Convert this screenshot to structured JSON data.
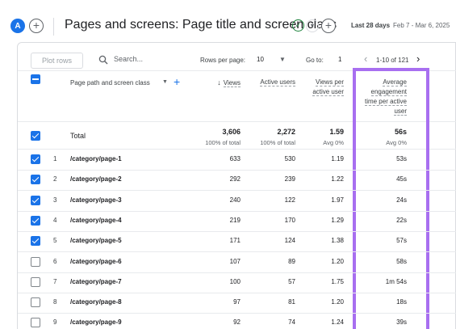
{
  "header": {
    "avatar_letter": "A",
    "title": "Pages and screens: Page title and screen class",
    "date_label": "Last 28 days",
    "date_range": "Feb 7 - Mar 6, 2025"
  },
  "toolbar": {
    "plot_rows_label": "Plot rows",
    "search_placeholder": "Search...",
    "rows_per_page_label": "Rows per page:",
    "rows_per_page_value": "10",
    "goto_label": "Go to:",
    "goto_value": "1",
    "page_range": "1-10 of 121"
  },
  "table": {
    "dimension_header": "Page path and screen class",
    "columns": [
      {
        "label": "Views",
        "sorted": true
      },
      {
        "label": "Active users"
      },
      {
        "label": "Views per active user"
      },
      {
        "label": "Average engagement time per active user"
      }
    ],
    "total": {
      "label": "Total",
      "values": [
        "3,606",
        "2,272",
        "1.59",
        "56s"
      ],
      "subs": [
        "100% of total",
        "100% of total",
        "Avg 0%",
        "Avg 0%"
      ]
    },
    "rows": [
      {
        "rank": "1",
        "path": "/category/page-1",
        "views": "633",
        "users": "530",
        "vpu": "1.19",
        "eng": "53s",
        "checked": true
      },
      {
        "rank": "2",
        "path": "/category/page-2",
        "views": "292",
        "users": "239",
        "vpu": "1.22",
        "eng": "45s",
        "checked": true
      },
      {
        "rank": "3",
        "path": "/category/page-3",
        "views": "240",
        "users": "122",
        "vpu": "1.97",
        "eng": "24s",
        "checked": true
      },
      {
        "rank": "4",
        "path": "/category/page-4",
        "views": "219",
        "users": "170",
        "vpu": "1.29",
        "eng": "22s",
        "checked": true
      },
      {
        "rank": "5",
        "path": "/category/page-5",
        "views": "171",
        "users": "124",
        "vpu": "1.38",
        "eng": "57s",
        "checked": true
      },
      {
        "rank": "6",
        "path": "/category/page-6",
        "views": "107",
        "users": "89",
        "vpu": "1.20",
        "eng": "58s",
        "checked": false
      },
      {
        "rank": "7",
        "path": "/category/page-7",
        "views": "100",
        "users": "57",
        "vpu": "1.75",
        "eng": "1m 54s",
        "checked": false
      },
      {
        "rank": "8",
        "path": "/category/page-8",
        "views": "97",
        "users": "81",
        "vpu": "1.20",
        "eng": "18s",
        "checked": false
      },
      {
        "rank": "9",
        "path": "/category/page-9",
        "views": "92",
        "users": "74",
        "vpu": "1.24",
        "eng": "39s",
        "checked": false
      }
    ]
  },
  "colors": {
    "accent": "#1a73e8",
    "highlight": "#a86ff0",
    "success": "#188038"
  }
}
